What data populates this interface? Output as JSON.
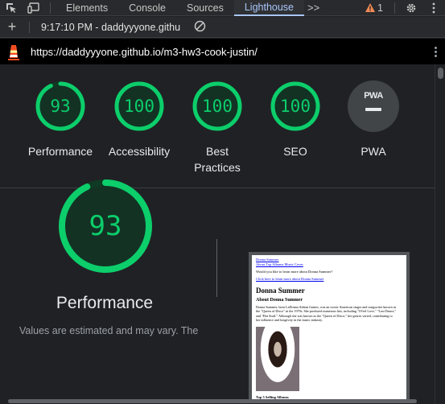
{
  "devtools": {
    "tabs": [
      {
        "label": "Elements",
        "active": false
      },
      {
        "label": "Console",
        "active": false
      },
      {
        "label": "Sources",
        "active": false
      },
      {
        "label": "Lighthouse",
        "active": true
      }
    ],
    "more_tabs_label": ">>",
    "warning_count": "1",
    "icons": [
      "inspect-element-icon",
      "device-toolbar-icon",
      "warning-icon",
      "gear-icon",
      "kebab-menu-icon"
    ]
  },
  "toolbar": {
    "add_label": "+",
    "report_select": "9:17:10 PM - daddyyyone.githu",
    "icons": [
      "plus-icon",
      "chevron-down-icon",
      "clear-icon"
    ]
  },
  "urlbar": {
    "url": "https://daddyyyone.github.io/m3-hw3-cook-justin/",
    "icons": [
      "lighthouse-logo-icon",
      "kebab-menu-icon"
    ]
  },
  "scores": [
    {
      "label": "Performance",
      "value": "93",
      "fraction": 0.93
    },
    {
      "label": "Accessibility",
      "value": "100",
      "fraction": 1.0
    },
    {
      "label": "Best Practices",
      "value": "100",
      "fraction": 1.0
    },
    {
      "label": "SEO",
      "value": "100",
      "fraction": 1.0
    }
  ],
  "pwa": {
    "label": "PWA",
    "badge_text": "PWA"
  },
  "performance_detail": {
    "value": "93",
    "fraction": 0.93,
    "label": "Performance",
    "disclaimer": "Values are estimated and may vary. The"
  },
  "page_preview": {
    "nav_top": "Donna Summer",
    "nav_links": "About Top Albums Music Cover",
    "question": "Would you like to learn more about Donna Summer?",
    "cta_link": "Click here to learn more about Donna Summer",
    "heading": "Donna Summer",
    "subheading": "About Donna Summer",
    "paragraph": "Donna Summer, born LaDonna Adrian Gaines, was an iconic American singer and songwriter known as the \"Queen of Disco\" in the 1970s. She produced numerous hits, including \"I Feel Love,\" \"Last Dance,\" and \"Hot Stuff.\" Although she was known as the \"Queen of Disco,\" her genres varied, contributing to her influence and longevity in the music industry.",
    "albums_heading": "Top 5 Selling Albums"
  },
  "colors": {
    "pass_green": "#0cce6b",
    "gauge_track": "#0f3a23",
    "accent_blue": "#a8c7fa",
    "warning_orange": "#f28b54"
  }
}
